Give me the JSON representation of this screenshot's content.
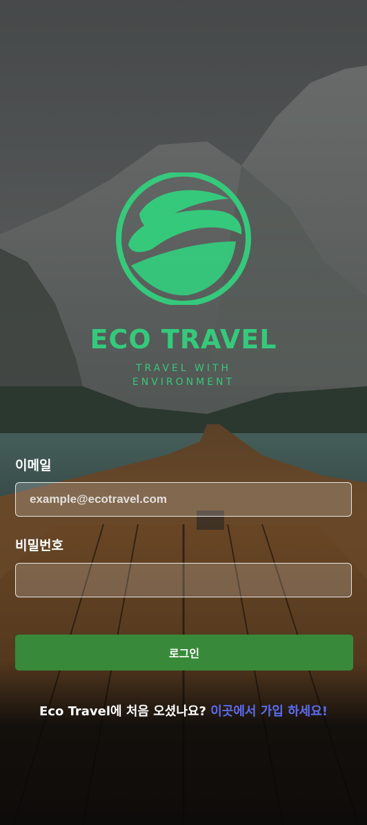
{
  "brand": {
    "name": "ECO TRAVEL",
    "tagline_line1": "TRAVEL WITH",
    "tagline_line2": "ENVIRONMENT",
    "color": "#35c97c"
  },
  "form": {
    "email_label": "이메일",
    "email_placeholder": "example@ecotravel.com",
    "password_label": "비밀번호",
    "password_placeholder": "",
    "login_button_label": "로그인",
    "button_color": "#388a3a"
  },
  "signup": {
    "prompt": "Eco Travel에 처음 오셨나요? ",
    "link_text": "이곳에서 가입 하세요!",
    "link_color": "#5b6cf0"
  }
}
